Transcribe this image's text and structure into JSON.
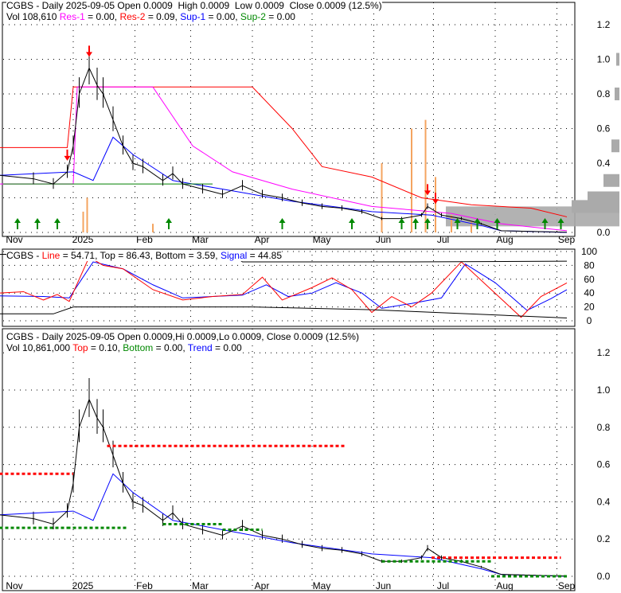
{
  "panel1": {
    "symbol": "CGBS - Daily 2025-09-05",
    "open": "Open 0.0009",
    "high": "High 0.0009",
    "low": "Low 0.0009",
    "close": "Close 0.0009 (12.5%)",
    "vol": "Vol 108,610",
    "res1": "Res-1",
    "res1v": " = 0.00, ",
    "res2": "Res-2",
    "res2v": " = 0.09, ",
    "sup1": "Sup-1",
    "sup1v": " = 0.00, ",
    "sup2": "Sup-2",
    "sup2v": " = 0.00"
  },
  "panel2": {
    "symbol": "CGBS - ",
    "line": "Line",
    "linev": " = 54.71, Top = 86.43, Bottom = 3.59, ",
    "signal": "Signal",
    "signalv": " = 44.85"
  },
  "panel3": {
    "line1": "CGBS - Daily 2025-09-05 Open 0.0009,Hi 0.0009,Lo 0.0009, Close 0.0009 (12.5%)",
    "vol": "Vol 10,861,000 ",
    "top": "Top",
    "topv": " = 0.10, ",
    "bottom": "Bottom",
    "bottomv": " = 0.00, ",
    "trend": "Trend",
    "trendv": " = 0.00"
  },
  "colors": {
    "res1": "#ff00ff",
    "res2": "#ff0000",
    "sup1": "#0000ff",
    "sup2": "#008000",
    "volume": "#f4a460"
  },
  "chart_data": {
    "type": "line",
    "x_unit": "days since 2025-01-01",
    "month_labels": [
      "Nov",
      "2025",
      "Feb",
      "Mar",
      "Apr",
      "May",
      "Jun",
      "Jul",
      "Aug",
      "Sep"
    ],
    "month_days": [
      -50,
      0,
      31,
      59,
      90,
      120,
      151,
      181,
      212,
      243
    ],
    "price_ticks": [
      "0.0",
      "0.2",
      "0.4",
      "0.6",
      "0.8",
      "1.0",
      "1.2"
    ],
    "osc_ticks": [
      "0",
      "20",
      "40",
      "60",
      "80",
      "100"
    ],
    "ylim": [
      0,
      1.25
    ],
    "close": [
      [
        -37,
        0.33
      ],
      [
        -20,
        0.31
      ],
      [
        -10,
        0.28
      ],
      [
        -3,
        0.35
      ],
      [
        0,
        0.5
      ],
      [
        3,
        0.8
      ],
      [
        8,
        0.95
      ],
      [
        12,
        0.85
      ],
      [
        15,
        0.8
      ],
      [
        20,
        0.65
      ],
      [
        25,
        0.5
      ],
      [
        30,
        0.4
      ],
      [
        35,
        0.38
      ],
      [
        45,
        0.3
      ],
      [
        50,
        0.34
      ],
      [
        55,
        0.28
      ],
      [
        65,
        0.25
      ],
      [
        75,
        0.22
      ],
      [
        85,
        0.27
      ],
      [
        95,
        0.22
      ],
      [
        105,
        0.2
      ],
      [
        115,
        0.17
      ],
      [
        125,
        0.15
      ],
      [
        135,
        0.14
      ],
      [
        145,
        0.12
      ],
      [
        155,
        0.08
      ],
      [
        165,
        0.08
      ],
      [
        175,
        0.1
      ],
      [
        178,
        0.15
      ],
      [
        185,
        0.1
      ],
      [
        195,
        0.08
      ],
      [
        205,
        0.05
      ],
      [
        215,
        0.01
      ],
      [
        248,
        0.001
      ]
    ],
    "res1": [
      [
        -37,
        0.28
      ],
      [
        0,
        0.28
      ],
      [
        2,
        0.84
      ],
      [
        40,
        0.84
      ],
      [
        60,
        0.5
      ],
      [
        80,
        0.35
      ],
      [
        110,
        0.25
      ],
      [
        150,
        0.15
      ],
      [
        190,
        0.11
      ],
      [
        215,
        0.05
      ],
      [
        248,
        0.01
      ]
    ],
    "res2": [
      [
        -37,
        0.49
      ],
      [
        -3,
        0.49
      ],
      [
        0,
        0.84
      ],
      [
        90,
        0.84
      ],
      [
        110,
        0.6
      ],
      [
        125,
        0.38
      ],
      [
        150,
        0.32
      ],
      [
        175,
        0.2
      ],
      [
        200,
        0.16
      ],
      [
        230,
        0.14
      ],
      [
        248,
        0.09
      ]
    ],
    "sup1": [
      [
        -37,
        0.33
      ],
      [
        0,
        0.35
      ],
      [
        10,
        0.3
      ],
      [
        20,
        0.55
      ],
      [
        30,
        0.45
      ],
      [
        50,
        0.3
      ],
      [
        80,
        0.24
      ],
      [
        110,
        0.18
      ],
      [
        150,
        0.12
      ],
      [
        180,
        0.1
      ],
      [
        205,
        0.04
      ],
      [
        215,
        0.01
      ],
      [
        248,
        0.0
      ]
    ],
    "volume": [
      [
        5,
        0.12
      ],
      [
        7,
        0.2
      ],
      [
        40,
        0.05
      ],
      [
        155,
        0.4
      ],
      [
        170,
        0.6
      ],
      [
        177,
        0.65
      ],
      [
        182,
        0.32
      ],
      [
        190,
        0.1
      ],
      [
        200,
        0.06
      ]
    ],
    "osc_line": [
      [
        -37,
        40
      ],
      [
        -25,
        42
      ],
      [
        -15,
        30
      ],
      [
        -8,
        38
      ],
      [
        -2,
        28
      ],
      [
        8,
        92
      ],
      [
        15,
        80
      ],
      [
        25,
        75
      ],
      [
        40,
        45
      ],
      [
        55,
        30
      ],
      [
        70,
        35
      ],
      [
        85,
        38
      ],
      [
        95,
        63
      ],
      [
        105,
        30
      ],
      [
        120,
        48
      ],
      [
        130,
        62
      ],
      [
        140,
        45
      ],
      [
        150,
        12
      ],
      [
        160,
        35
      ],
      [
        170,
        20
      ],
      [
        180,
        40
      ],
      [
        195,
        85
      ],
      [
        210,
        45
      ],
      [
        225,
        5
      ],
      [
        235,
        35
      ],
      [
        248,
        54.71
      ]
    ],
    "osc_signal": [
      [
        -37,
        36
      ],
      [
        -15,
        35
      ],
      [
        -2,
        33
      ],
      [
        10,
        85
      ],
      [
        25,
        75
      ],
      [
        40,
        52
      ],
      [
        55,
        33
      ],
      [
        70,
        35
      ],
      [
        85,
        37
      ],
      [
        97,
        52
      ],
      [
        108,
        35
      ],
      [
        120,
        40
      ],
      [
        132,
        55
      ],
      [
        145,
        40
      ],
      [
        155,
        18
      ],
      [
        170,
        25
      ],
      [
        185,
        33
      ],
      [
        197,
        82
      ],
      [
        212,
        55
      ],
      [
        228,
        15
      ],
      [
        240,
        32
      ],
      [
        248,
        44.85
      ]
    ],
    "buy_arrows_p1": [
      -28,
      -18,
      -8,
      48,
      105,
      140,
      165,
      172,
      178,
      193,
      203,
      213,
      237,
      245
    ],
    "sell_arrows_p1": [
      8,
      -3,
      178,
      182
    ]
  }
}
